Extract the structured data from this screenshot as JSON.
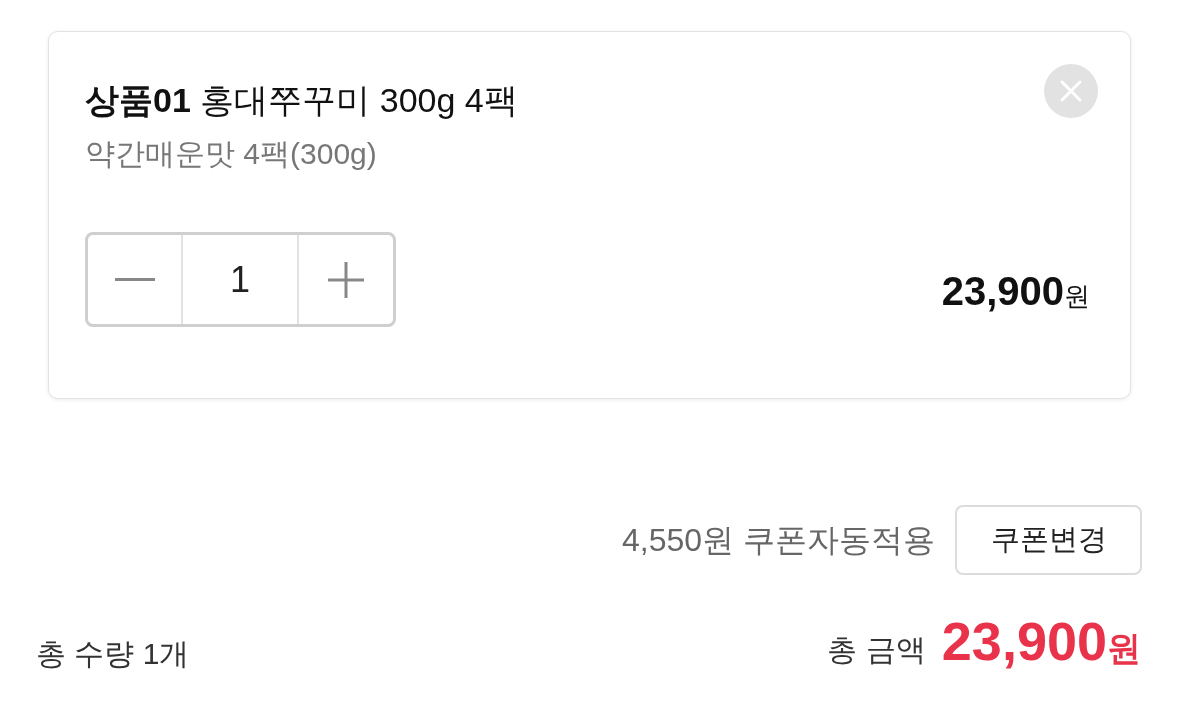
{
  "cart_item": {
    "title_bold": "상품01",
    "title": "홍대쭈꾸미 300g 4팩",
    "option": "약간매운맛 4팩(300g)",
    "quantity": "1",
    "price": "23,900",
    "price_unit": "원"
  },
  "coupon": {
    "text": "4,550원 쿠폰자동적용",
    "button": "쿠폰변경"
  },
  "summary": {
    "total_quantity": "총 수량 1개",
    "total_label": "총 금액",
    "total_price": "23,900",
    "total_unit": "원"
  }
}
